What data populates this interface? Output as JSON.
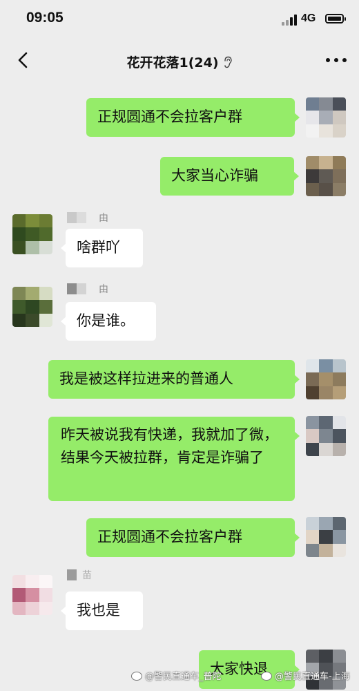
{
  "status_bar": {
    "time": "09:05",
    "network": "4G",
    "battery_level": 0.85
  },
  "header": {
    "title": "花开花落1(24)",
    "back_icon": "chevron-left-icon",
    "mute_icon": "ear-icon",
    "more_icon": "more-dots-icon"
  },
  "messages": [
    {
      "side": "sent",
      "text": "正规圆通不会拉客户群"
    },
    {
      "side": "sent",
      "text": "大家当心诈骗"
    },
    {
      "side": "received",
      "sender_suffix": "由",
      "text": "啥群吖"
    },
    {
      "side": "received",
      "sender_suffix": "由",
      "text": "你是谁。"
    },
    {
      "side": "sent",
      "text": "我是被这样拉进来的普通人"
    },
    {
      "side": "sent",
      "text": "昨天被说我有快递，我就加了微，结果今天被拉群，肯定是诈骗了"
    },
    {
      "side": "sent",
      "text": "正规圆通不会拉客户群"
    },
    {
      "side": "received",
      "sender_suffix": "苗",
      "text": "我也是"
    },
    {
      "side": "sent",
      "text": "大家快退"
    }
  ],
  "watermark": {
    "left": "@警民直通车_普陀",
    "right": "@警民直通车-上海"
  },
  "colors": {
    "background": "#ededed",
    "sent_bubble": "#95ec69",
    "received_bubble": "#ffffff"
  }
}
